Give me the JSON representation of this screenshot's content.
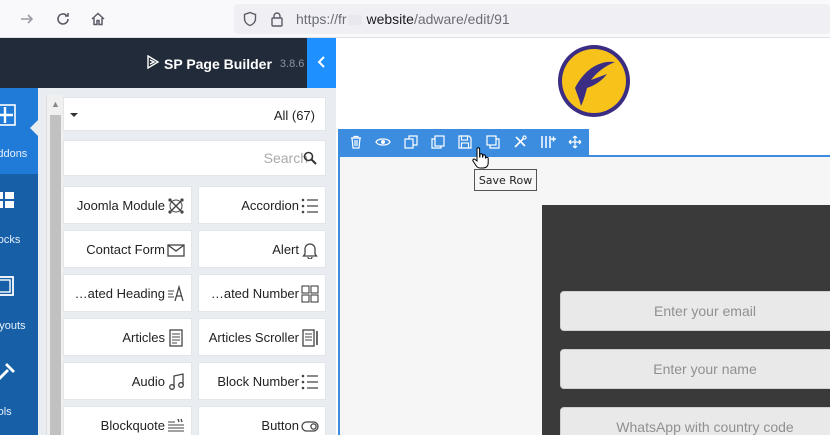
{
  "browser": {
    "url_prefix": "https://fr",
    "url_host": "website",
    "url_path": "/adware/edit/91"
  },
  "builder": {
    "brand": "SP Page Builder",
    "version": "3.8.6"
  },
  "rail": [
    {
      "label": "Addons",
      "icon": "plus-icon",
      "active": true
    },
    {
      "label": "Blocks",
      "icon": "blocks-icon",
      "active": false
    },
    {
      "label": "Layouts",
      "icon": "layouts-icon",
      "active": false
    },
    {
      "label": "Tools",
      "icon": "tools-icon",
      "active": false
    }
  ],
  "addons_panel": {
    "filter_value": "All (67)",
    "search_placeholder": "Search",
    "items": [
      {
        "name": "Joomla Module",
        "icon": "joomla-icon"
      },
      {
        "name": "Accordion",
        "icon": "list-icon"
      },
      {
        "name": "Contact Form",
        "icon": "envelope-icon"
      },
      {
        "name": "Alert",
        "icon": "bell-icon"
      },
      {
        "name": "…ated Heading",
        "icon": "heading-icon"
      },
      {
        "name": "…ated Number",
        "icon": "number-icon"
      },
      {
        "name": "Articles",
        "icon": "article-icon"
      },
      {
        "name": "Articles Scroller",
        "icon": "article-scroller-icon"
      },
      {
        "name": "Audio",
        "icon": "music-icon"
      },
      {
        "name": "Block Number",
        "icon": "list-icon"
      },
      {
        "name": "Blockquote",
        "icon": "quote-icon"
      },
      {
        "name": "Button",
        "icon": "toggle-icon"
      }
    ]
  },
  "row_toolbar": {
    "tooltip": "Save Row",
    "buttons": [
      "delete",
      "toggle-visibility",
      "duplicate",
      "copy",
      "save-row",
      "paste",
      "settings",
      "add-columns",
      "move"
    ]
  },
  "form": {
    "email_placeholder": "Enter your email",
    "name_placeholder": "Enter your name",
    "whatsapp_placeholder": "WhatsApp with country code"
  },
  "colors": {
    "header_bg": "#222b3a",
    "rail_bg": "#1760a8",
    "accent": "#1e90ff",
    "toolbar": "#3c8de0",
    "logo_yellow": "#f7c21a",
    "logo_purple": "#3b2d84"
  }
}
